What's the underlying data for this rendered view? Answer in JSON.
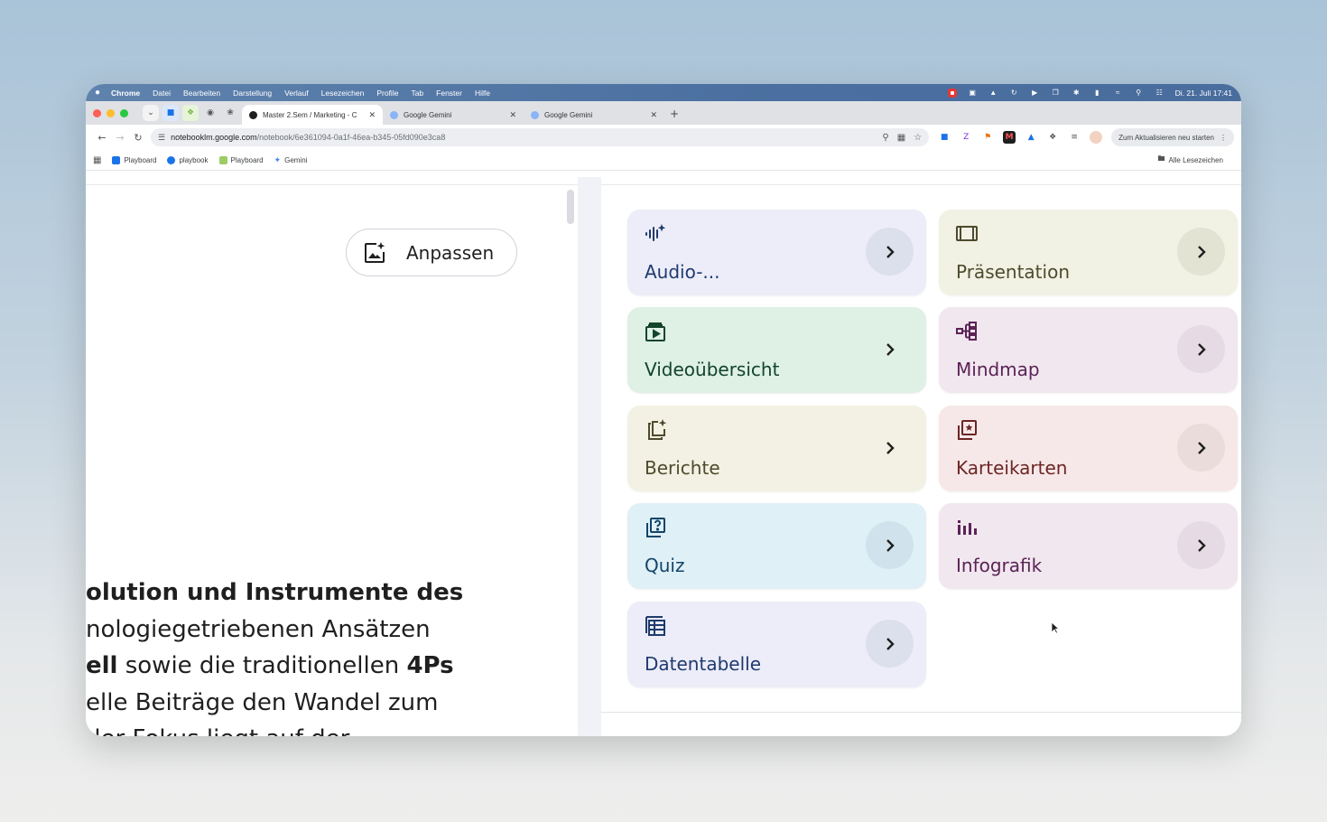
{
  "menubar": {
    "apple": "",
    "app_name": "Chrome",
    "menus": [
      "Datei",
      "Bearbeiten",
      "Darstellung",
      "Verlauf",
      "Lesezeichen",
      "Profile",
      "Tab",
      "Fenster",
      "Hilfe"
    ],
    "clock": "Di. 21. Juli 17:41"
  },
  "tabs": [
    {
      "title": "Master 2.Sem / Marketing - C",
      "active": true
    },
    {
      "title": "Google Gemini",
      "active": false
    },
    {
      "title": "Google Gemini",
      "active": false
    }
  ],
  "toolbar": {
    "url_host": "notebooklm.google.com",
    "url_path": "/notebook/6e361094-0a1f-46ea-b345-05fd090e3ca8",
    "update_button": "Zum Aktualisieren neu starten"
  },
  "bookmarks": {
    "items": [
      "Playboard",
      "playbook",
      "Playboard",
      "Gemini"
    ],
    "all_bookmarks": "Alle Lesezeichen"
  },
  "left": {
    "customize_button": "Anpassen",
    "summary": {
      "l1": "olution und Instrumente des",
      "l2": "nologiegetriebenen Ansätzen",
      "l3_bold": "ell",
      "l3_mid": " sowie die traditionellen ",
      "l3_bold2": "4Ps",
      "l4": "elle Beiträge den Wandel zum",
      "l5": "der Fokus liegt auf der"
    }
  },
  "studio": {
    "cards": [
      {
        "label": "Audio-...",
        "icon": "audio-spark-icon",
        "bg": "#ecedf8",
        "fg": "#1f3a6e",
        "arrow_bg": "#dcdfec"
      },
      {
        "label": "Präsentation",
        "icon": "slides-icon",
        "bg": "#f1f1e4",
        "fg": "#4e4b2c",
        "arrow_bg": "#e3e3d4"
      },
      {
        "label": "Videoübersicht",
        "icon": "video-overview-icon",
        "bg": "#dff0e4",
        "fg": "#12452a",
        "arrow_bg": "#dff0e4"
      },
      {
        "label": "Mindmap",
        "icon": "mindmap-icon",
        "bg": "#f1e7ef",
        "fg": "#5b2356",
        "arrow_bg": "#e6dbe4"
      },
      {
        "label": "Berichte",
        "icon": "reports-icon",
        "bg": "#f2f1e3",
        "fg": "#4e4a2c",
        "arrow_bg": "#f2f1e3"
      },
      {
        "label": "Karteikarten",
        "icon": "flashcards-icon",
        "bg": "#f6e8e8",
        "fg": "#6d2525",
        "arrow_bg": "#ebdcdc"
      },
      {
        "label": "Quiz",
        "icon": "quiz-icon",
        "bg": "#dff0f6",
        "fg": "#12456a",
        "arrow_bg": "#d0e3ec"
      },
      {
        "label": "Infografik",
        "icon": "infographic-icon",
        "bg": "#f1e7ef",
        "fg": "#5b2356",
        "arrow_bg": "#e6dbe4"
      },
      {
        "label": "Datentabelle",
        "icon": "data-table-icon",
        "bg": "#ecedf8",
        "fg": "#1f3a6e",
        "arrow_bg": "#dcdfec"
      }
    ]
  }
}
